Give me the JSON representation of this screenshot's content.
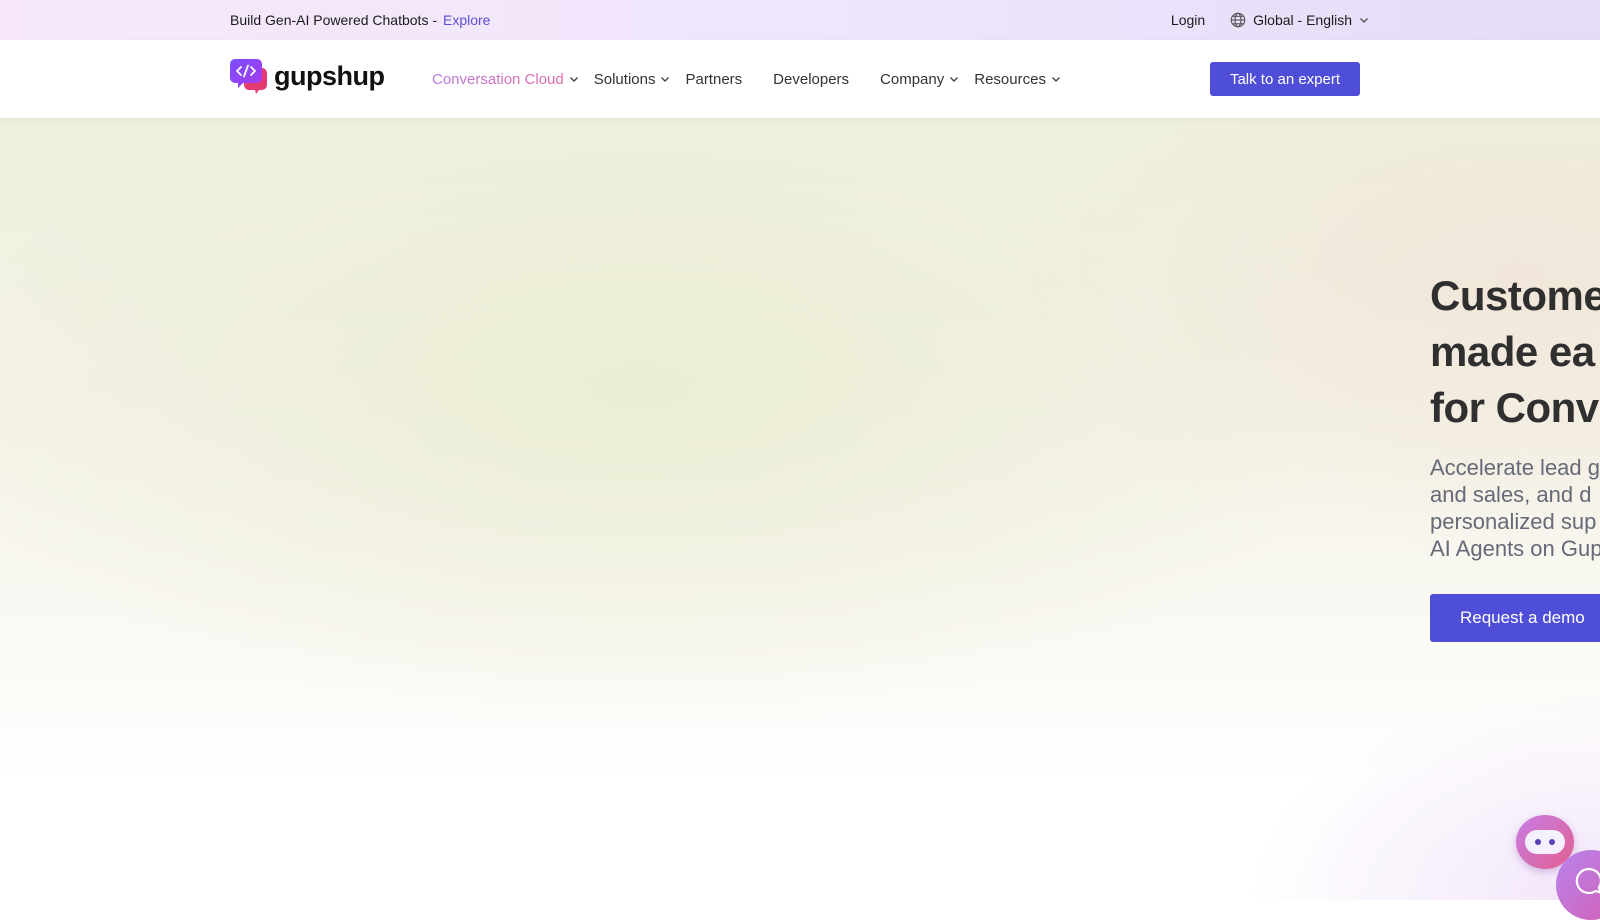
{
  "announcement": {
    "promo_text": "Build Gen-AI Powered Chatbots -",
    "explore_label": "Explore",
    "login_label": "Login",
    "language_label": "Global - English",
    "globe_icon": "globe-icon",
    "chevron_icon": "chevron-down-icon"
  },
  "nav": {
    "logo_text": "gupshup",
    "logo_icon": "code-chat-bubble-icon",
    "items": [
      {
        "label": "Conversation Cloud",
        "has_dropdown": true,
        "active": true
      },
      {
        "label": "Solutions",
        "has_dropdown": true
      },
      {
        "label": "Partners",
        "has_dropdown": false
      },
      {
        "label": "Developers",
        "has_dropdown": false
      },
      {
        "label": "Company",
        "has_dropdown": true
      },
      {
        "label": "Resources",
        "has_dropdown": true
      }
    ],
    "cta_label": "Talk to an expert"
  },
  "hero": {
    "heading_lines": [
      "Custome",
      "made ea",
      "for Conve"
    ],
    "subtext_lines": [
      "Accelerate lead g",
      "and sales, and d",
      "personalized sup",
      "AI Agents on Gup"
    ],
    "cta_label": "Request a demo"
  },
  "widgets": {
    "bot_icon": "chatbot-face-icon",
    "chat_icon": "chat-bubble-icon"
  },
  "colors": {
    "accent": "#4f4ed8",
    "explore_link": "#5a4fd6",
    "active_nav_gradient_start": "#b678e0",
    "active_nav_gradient_end": "#e26aa6",
    "heading": "#2f2f2f",
    "subtext": "#666a78"
  }
}
